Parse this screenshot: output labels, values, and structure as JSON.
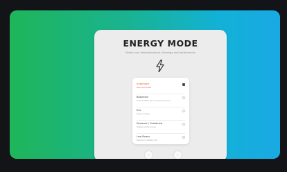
{
  "modal": {
    "title": "ENERGY MODE",
    "subtitle": "Select your desired balance of energy and performance"
  },
  "options": [
    {
      "label": "Automatic",
      "desc": "Recommended",
      "selected": true
    },
    {
      "label": "Balanced",
      "desc": "Good battery life and performance",
      "selected": false
    },
    {
      "label": "Eco",
      "desc": "Saves energy",
      "selected": false
    },
    {
      "label": "Dynamic / Sustained",
      "desc": "Higher performance",
      "selected": false
    },
    {
      "label": "Low Power",
      "desc": "Maximum battery life",
      "selected": false
    }
  ],
  "nav": {
    "prev_icon": "chevron-down-icon",
    "next_icon": "chevron-down-icon",
    "prev_glyph": "⌄",
    "next_glyph": "⌄"
  },
  "colors": {
    "gradient_start": "#1fb55a",
    "gradient_end": "#1aa9e3",
    "accent": "#e0602e"
  }
}
